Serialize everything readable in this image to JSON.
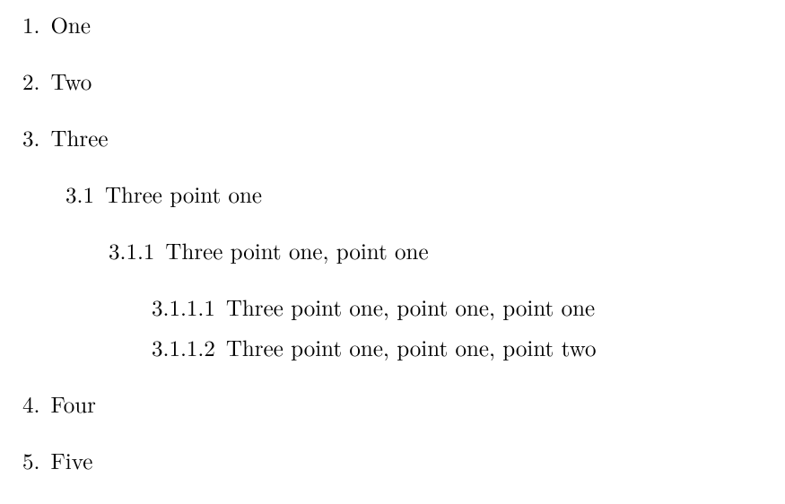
{
  "list": {
    "i0": {
      "num": "1",
      "text": "One"
    },
    "i1": {
      "num": "2",
      "text": "Two"
    },
    "i2": {
      "num": "3",
      "text": "Three"
    },
    "i2_0": {
      "num": "3.1",
      "text": "Three point one"
    },
    "i2_0_0": {
      "num": "3.1.1",
      "text": "Three point one, point one"
    },
    "i2_0_0_0": {
      "num": "3.1.1.1",
      "text": "Three point one, point one, point one"
    },
    "i2_0_0_1": {
      "num": "3.1.1.2",
      "text": "Three point one, point one, point two"
    },
    "i3": {
      "num": "4",
      "text": "Four"
    },
    "i4": {
      "num": "5",
      "text": "Five"
    }
  }
}
